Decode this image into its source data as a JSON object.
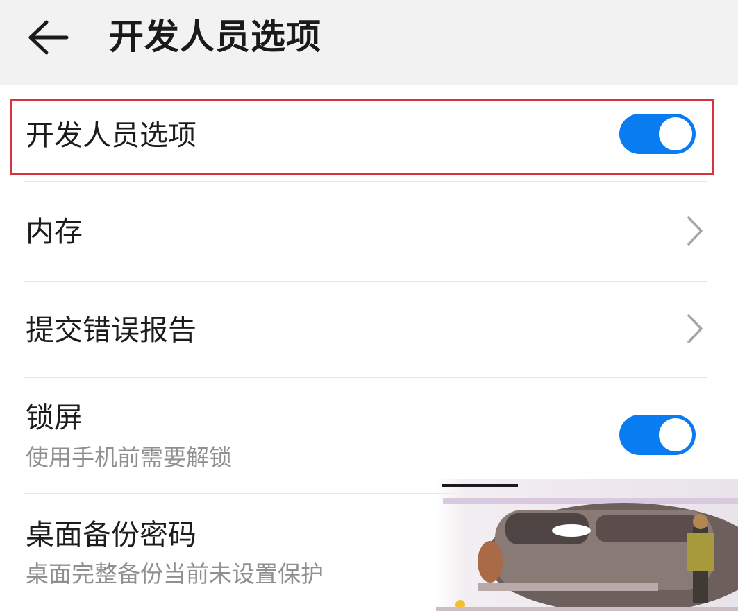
{
  "app_bar": {
    "title": "开发人员选项",
    "back_icon": "arrow-left-icon"
  },
  "colors": {
    "accent": "#0a7cf2",
    "highlight": "#d6343f",
    "app_bar_bg": "#f2f2f2"
  },
  "settings": {
    "developer_options": {
      "label": "开发人员选项",
      "enabled": true
    },
    "memory": {
      "label": "内存"
    },
    "bug_report": {
      "label": "提交错误报告"
    },
    "lock_screen": {
      "label": "锁屏",
      "description": "使用手机前需要解锁",
      "enabled": true
    },
    "desktop_backup_password": {
      "label": "桌面备份密码",
      "description": "桌面完整备份当前未设置保护"
    }
  }
}
